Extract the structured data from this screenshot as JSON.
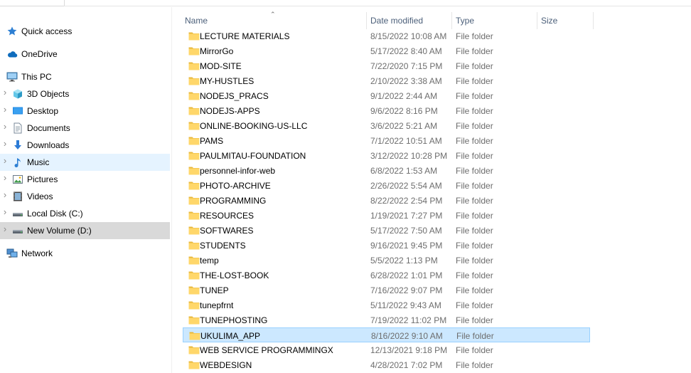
{
  "nav": {
    "items": [
      {
        "label": "Quick access",
        "icon": "star-icon",
        "has_chevron": false,
        "state": "normal"
      },
      {
        "label": "OneDrive",
        "icon": "cloud-icon",
        "has_chevron": false,
        "state": "normal"
      },
      {
        "label": "This PC",
        "icon": "computer-icon",
        "has_chevron": false,
        "state": "normal"
      },
      {
        "label": "3D Objects",
        "icon": "cube-icon",
        "has_chevron": true,
        "state": "normal"
      },
      {
        "label": "Desktop",
        "icon": "desktop-icon",
        "has_chevron": true,
        "state": "normal"
      },
      {
        "label": "Documents",
        "icon": "document-icon",
        "has_chevron": true,
        "state": "normal"
      },
      {
        "label": "Downloads",
        "icon": "download-icon",
        "has_chevron": true,
        "state": "normal"
      },
      {
        "label": "Music",
        "icon": "music-icon",
        "has_chevron": true,
        "state": "hover"
      },
      {
        "label": "Pictures",
        "icon": "picture-icon",
        "has_chevron": true,
        "state": "normal"
      },
      {
        "label": "Videos",
        "icon": "video-icon",
        "has_chevron": true,
        "state": "normal"
      },
      {
        "label": "Local Disk (C:)",
        "icon": "drive-icon",
        "has_chevron": true,
        "state": "normal"
      },
      {
        "label": "New Volume (D:)",
        "icon": "drive-icon",
        "has_chevron": true,
        "state": "selected"
      },
      {
        "label": "Network",
        "icon": "network-icon",
        "has_chevron": false,
        "state": "normal"
      }
    ]
  },
  "columns": {
    "name": "Name",
    "date": "Date modified",
    "type": "Type",
    "size": "Size"
  },
  "files": [
    {
      "name": "LECTURE MATERIALS",
      "date": "8/15/2022 10:08 AM",
      "type": "File folder"
    },
    {
      "name": "MirrorGo",
      "date": "5/17/2022 8:40 AM",
      "type": "File folder"
    },
    {
      "name": "MOD-SITE",
      "date": "7/22/2020 7:15 PM",
      "type": "File folder"
    },
    {
      "name": "MY-HUSTLES",
      "date": "2/10/2022 3:38 AM",
      "type": "File folder"
    },
    {
      "name": "NODEJS_PRACS",
      "date": "9/1/2022 2:44 AM",
      "type": "File folder"
    },
    {
      "name": "NODEJS-APPS",
      "date": "9/6/2022 8:16 PM",
      "type": "File folder"
    },
    {
      "name": "ONLINE-BOOKING-US-LLC",
      "date": "3/6/2022 5:21 AM",
      "type": "File folder"
    },
    {
      "name": "PAMS",
      "date": "7/1/2022 10:51 AM",
      "type": "File folder"
    },
    {
      "name": "PAULMITAU-FOUNDATION",
      "date": "3/12/2022 10:28 PM",
      "type": "File folder"
    },
    {
      "name": "personnel-infor-web",
      "date": "6/8/2022 1:53 AM",
      "type": "File folder"
    },
    {
      "name": "PHOTO-ARCHIVE",
      "date": "2/26/2022 5:54 AM",
      "type": "File folder"
    },
    {
      "name": "PROGRAMMING",
      "date": "8/22/2022 2:54 PM",
      "type": "File folder"
    },
    {
      "name": "RESOURCES",
      "date": "1/19/2021 7:27 PM",
      "type": "File folder"
    },
    {
      "name": "SOFTWARES",
      "date": "5/17/2022 7:50 AM",
      "type": "File folder"
    },
    {
      "name": "STUDENTS",
      "date": "9/16/2021 9:45 PM",
      "type": "File folder"
    },
    {
      "name": "temp",
      "date": "5/5/2022 1:13 PM",
      "type": "File folder"
    },
    {
      "name": "THE-LOST-BOOK",
      "date": "6/28/2022 1:01 PM",
      "type": "File folder"
    },
    {
      "name": "TUNEP",
      "date": "7/16/2022 9:07 PM",
      "type": "File folder"
    },
    {
      "name": "tunepfrnt",
      "date": "5/11/2022 9:43 AM",
      "type": "File folder"
    },
    {
      "name": "TUNEPHOSTING",
      "date": "7/19/2022 11:02 PM",
      "type": "File folder"
    },
    {
      "name": "UKULIMA_APP",
      "date": "8/16/2022 9:10 AM",
      "type": "File folder",
      "selected": true
    },
    {
      "name": "WEB SERVICE PROGRAMMINGX",
      "date": "12/13/2021 9:18 PM",
      "type": "File folder"
    },
    {
      "name": "WEBDESIGN",
      "date": "4/28/2021 7:02 PM",
      "type": "File folder"
    }
  ],
  "colors": {
    "hover_bg": "#e5f3ff",
    "selected_nav_bg": "#d9d9d9",
    "selected_row_bg": "#cce8ff",
    "selected_row_border": "#99d1ff",
    "folder_yellow": "#ffd76a",
    "header_text": "#4c607a"
  }
}
